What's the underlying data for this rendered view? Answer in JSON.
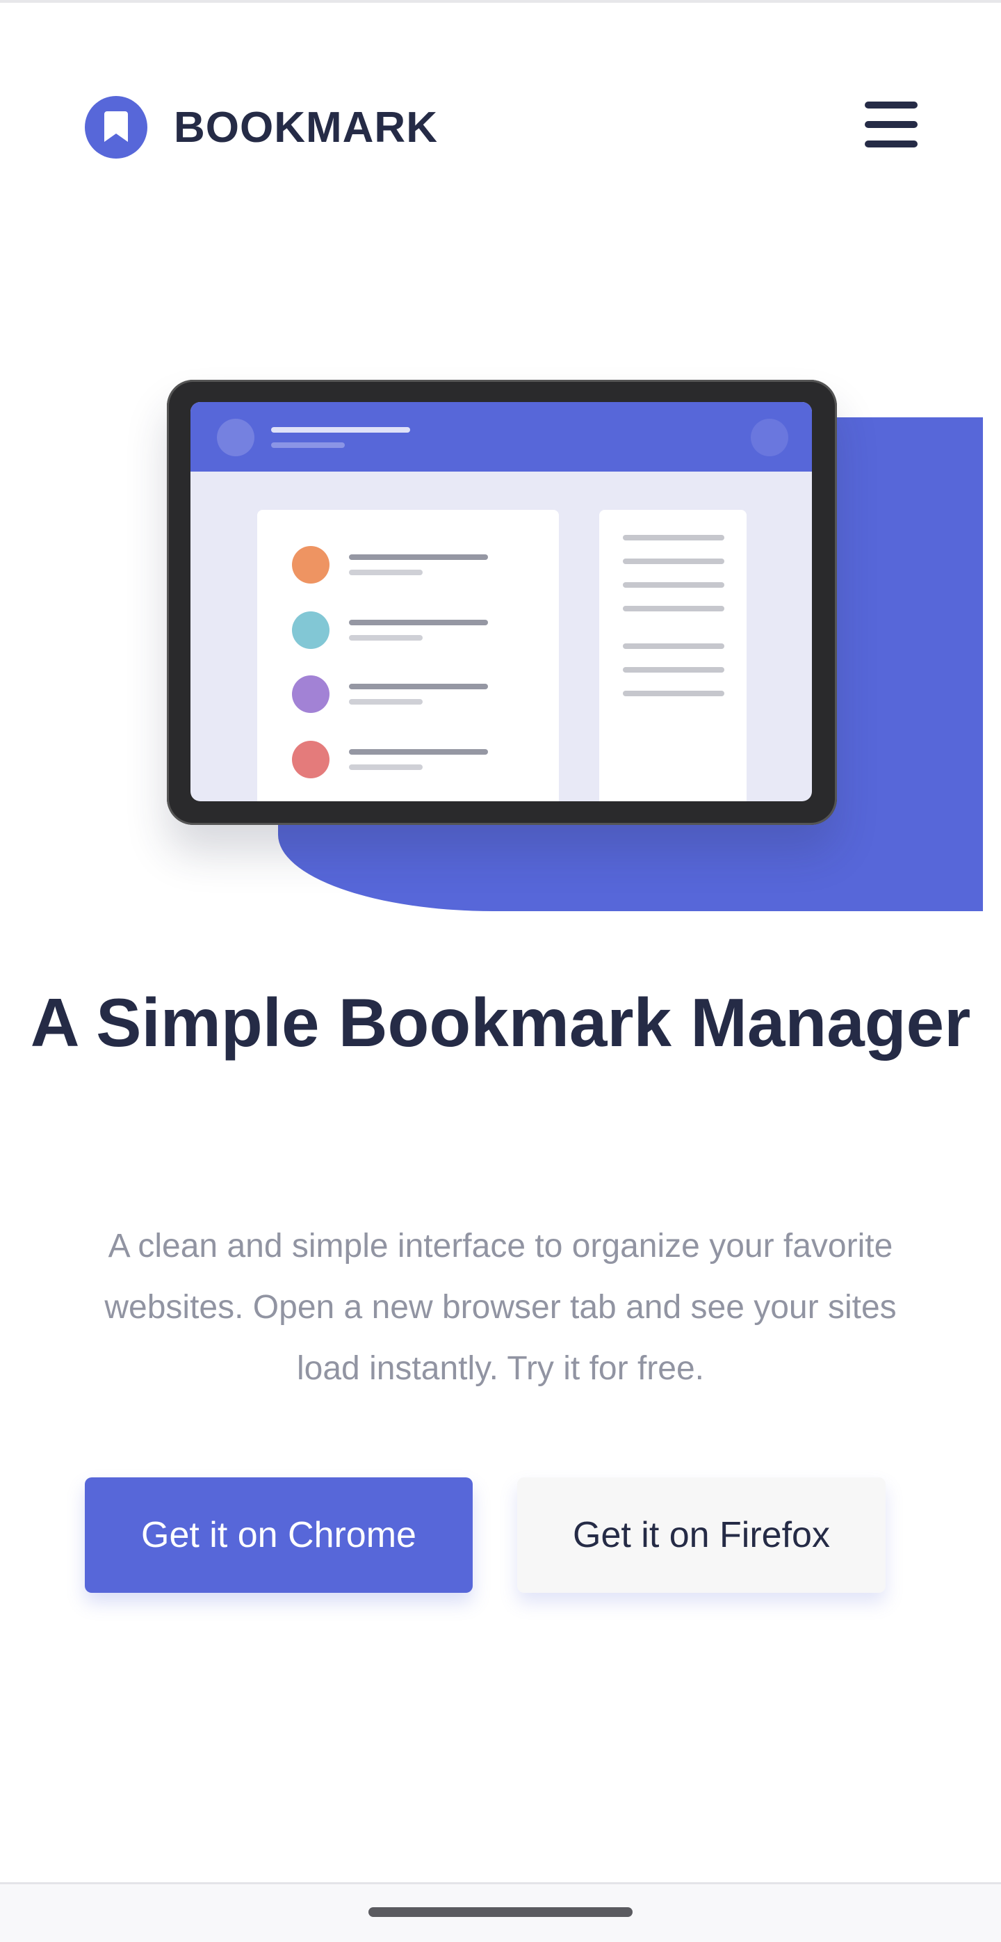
{
  "header": {
    "brand": "BOOKMARK",
    "logo_icon": "bookmark-icon",
    "menu_icon": "hamburger-menu-icon"
  },
  "hero": {
    "title": "A Simple Bookmark Manager",
    "description": "A clean and simple interface to organize your favorite websites. Open a new browser tab and see your sites load instantly. Try it for free."
  },
  "actions": {
    "chrome_label": "Get it on Chrome",
    "firefox_label": "Get it on Firefox"
  },
  "colors": {
    "accent": "#5767d9",
    "text_dark": "#252b46",
    "text_muted": "#9194a2",
    "bookmark_dots": [
      "#ee9462",
      "#82c7d5",
      "#a282d5",
      "#e47b7b"
    ]
  }
}
